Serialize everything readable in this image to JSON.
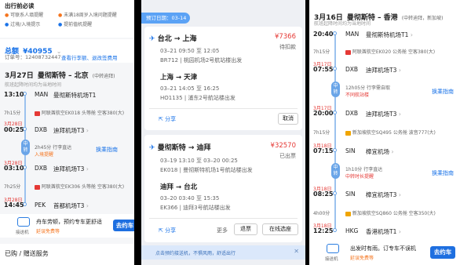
{
  "panelA": {
    "notice_title": "出行前必读",
    "notices": [
      "可联系人填提醒",
      "未满18周岁入境问题提醒",
      "过境/入境提示",
      "提前值机提醒"
    ],
    "total_label": "总额",
    "total_amount": "¥40955",
    "order_label": "订单号：",
    "order_no": "12408732447",
    "actions": "查看行李额、退改签费用",
    "date": "3月27日",
    "route": "曼彻斯特 – 北京",
    "via": "(中转迪拜)",
    "tz_note": "航班起降时间均为当地时间",
    "stops": [
      {
        "date": "",
        "time": "13:10",
        "code": "MAN",
        "airport": "曼彻斯特机场T1"
      },
      {
        "date": "3月28日",
        "time": "00:25",
        "code": "DXB",
        "airport": "迪拜机场T3"
      },
      {
        "date": "3月28日",
        "time": "03:10",
        "code": "DXB",
        "airport": "迪拜机场T3"
      },
      {
        "date": "3月28日",
        "time": "14:45",
        "code": "PEK",
        "airport": "首都机场T3"
      }
    ],
    "flight1": {
      "duration": "7h15分",
      "info": "阿联酋航空EK018",
      "cabin": "头等舱",
      "plane": "空客380(大)"
    },
    "transfer": {
      "label": "中转",
      "dur": "2h45分",
      "note": "行李直达",
      "extra": "入境提醒",
      "link": "换乘指南"
    },
    "flight2": {
      "duration": "7h25分",
      "info": "阿联酋航空EK306",
      "cabin": "头等舱",
      "plane": "空客380(大)"
    },
    "pickup_label": "接送机",
    "pickup_text": "舟车劳顿，预约专车更舒适",
    "pickup_sub": "延误免费等",
    "pickup_btn": "去约车",
    "bottom": "已购 / 赠送服务"
  },
  "panelB": {
    "badge": "预订日期：03-14",
    "card1": {
      "route_from": "台北",
      "route_to": "上海",
      "price": "¥7366",
      "status": "待扣款",
      "l1": "03–21 09:50 至 12:05",
      "l2": "BR712 | 桃园机场2号航站楼出发",
      "route2_from": "上海",
      "route2_to": "天津",
      "l3": "03–21 14:05 至 16:25",
      "l4": "HO1135 | 浦东2号航站楼出发",
      "share": "分享",
      "cancel": "取消"
    },
    "card2": {
      "route_from": "曼彻斯特",
      "route_to": "迪拜",
      "price": "¥32570",
      "status": "已出票",
      "l1": "03–19 13:10 至 03–20 00:25",
      "l2": "EK018 | 曼彻斯特机场1号航站楼出发",
      "route2_from": "迪拜",
      "route2_to": "台北",
      "l3": "03–20 03:40 至 15:35",
      "l4": "EK366 | 迪拜3号航站楼出发",
      "share": "分享",
      "more": "更多",
      "refund": "退票",
      "checkin": "在线选座"
    },
    "tip": "点击预约接送机，不惧风雨，舒适出行"
  },
  "panelC": {
    "date": "3月16日",
    "route": "曼彻斯特 – 香港",
    "via": "(中转迪拜，新加坡)",
    "tz_note": "航班起降时间均为当地时间",
    "stops": [
      {
        "date": "",
        "time": "20:40",
        "code": "MAN",
        "airport": "曼彻斯特机场T1"
      },
      {
        "date": "3月17日",
        "time": "07:55",
        "code": "DXB",
        "airport": "迪拜机场T3"
      },
      {
        "date": "3月17日",
        "time": "20:00",
        "code": "DXB",
        "airport": "迪拜机场T3"
      },
      {
        "date": "3月18日",
        "time": "07:15",
        "code": "SIN",
        "airport": "樟宜机场"
      },
      {
        "date": "3月18日",
        "time": "08:25",
        "code": "SIN",
        "airport": "樟宜机场T3"
      },
      {
        "date": "3月18日",
        "time": "12:25",
        "code": "HKG",
        "airport": "香港机场T1"
      }
    ],
    "f1": {
      "duration": "7h15分",
      "info": "阿联酋航空EK020",
      "cabin": "公务舱",
      "plane": "空客380(大)"
    },
    "tr1": {
      "label": "中转",
      "dur": "12h05分",
      "note": "行李需自取",
      "extra": "不同航站楼",
      "link": "换乘指南"
    },
    "f2": {
      "duration": "7h15分",
      "info": "新加坡航空SQ495",
      "cabin": "公务舱",
      "plane": "波音777(大)"
    },
    "tr2": {
      "label": "中转",
      "dur": "1h10分",
      "note": "行李直达",
      "extra": "中转时长提醒",
      "link": "换乘指南"
    },
    "f3": {
      "duration": "4h00分",
      "info": "新加坡航空SQ860",
      "cabin": "公务舱",
      "plane": "空客350(大)"
    },
    "pickup_label": "接送机",
    "pickup_text": "出发时有雨。订专车不误机",
    "pickup_sub": "延误免费等",
    "pickup_btn": "去约车"
  }
}
